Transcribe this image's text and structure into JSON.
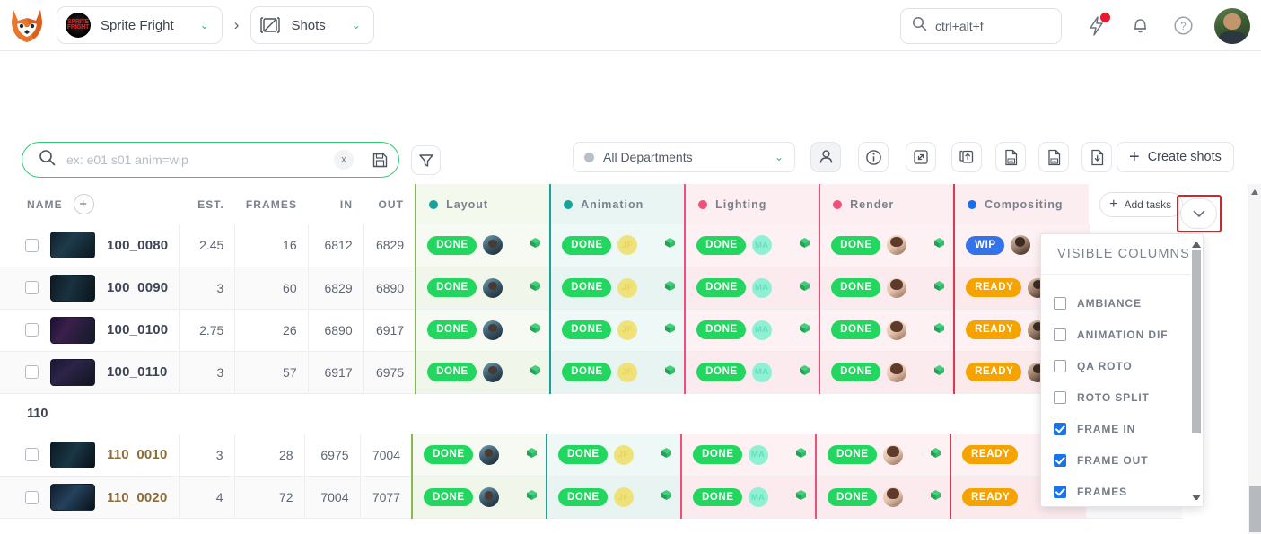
{
  "topbar": {
    "logo_name": "fox-logo",
    "project": "Sprite Fright",
    "project_thumb_text": "SPRITE FRIGHT",
    "breadcrumb_sep": "›",
    "entity": "Shots",
    "search_value": "ctrl+alt+f",
    "icons": [
      "lightning-icon",
      "bell-icon",
      "help-icon",
      "user-avatar"
    ]
  },
  "filterbar": {
    "search_placeholder": "ex: e01 s01 anim=wip",
    "clear_label": "x",
    "save_icon": "save-disk-icon",
    "filter_icon": "funnel-icon",
    "folder_icon": "folder-add-icon",
    "department": "All Departments",
    "person_icon": "person-icon",
    "info_icon": "info-circle-icon",
    "expand_icon": "expand-arrows-icon",
    "upload_icon": "upload-stack-icon",
    "edl_icon": "edl-file-icon",
    "csv_icon": "csv-file-icon",
    "download_icon": "download-file-icon",
    "create_label": "Create shots",
    "create_plus": "+"
  },
  "table": {
    "headers": {
      "name": "NAME",
      "add_column": "+",
      "est": "EST.",
      "frames": "FRAMES",
      "in": "IN",
      "out": "OUT"
    },
    "task_columns": [
      {
        "label": "Layout",
        "color": "#17a398"
      },
      {
        "label": "Animation",
        "color": "#17a398"
      },
      {
        "label": "Lighting",
        "color": "#f0507a"
      },
      {
        "label": "Render",
        "color": "#f0507a"
      },
      {
        "label": "Compositing",
        "color": "#1a6fe8"
      }
    ],
    "add_tasks_label": "Add tasks",
    "add_tasks_plus": "+",
    "expand_chevron": "chevron-down-icon",
    "groups": [
      {
        "name": "",
        "rows": [
          {
            "shot": "100_0080",
            "est": "2.45",
            "frames": "16",
            "in": "6812",
            "out": "6829",
            "tasks": [
              {
                "status": "DONE",
                "cls": "b-done",
                "av": "av-img1",
                "ini": ""
              },
              {
                "status": "DONE",
                "cls": "b-done",
                "av": "av-jf",
                "ini": "JF"
              },
              {
                "status": "DONE",
                "cls": "b-done",
                "av": "av-ma",
                "ini": "MA"
              },
              {
                "status": "DONE",
                "cls": "b-done",
                "av": "av-img2",
                "ini": ""
              },
              {
                "status": "WIP",
                "cls": "b-wip",
                "av": "av-img3",
                "ini": ""
              }
            ]
          },
          {
            "shot": "100_0090",
            "est": "3",
            "frames": "60",
            "in": "6829",
            "out": "6890",
            "tasks": [
              {
                "status": "DONE",
                "cls": "b-done",
                "av": "av-img1",
                "ini": ""
              },
              {
                "status": "DONE",
                "cls": "b-done",
                "av": "av-jf",
                "ini": "JF"
              },
              {
                "status": "DONE",
                "cls": "b-done",
                "av": "av-ma",
                "ini": "MA"
              },
              {
                "status": "DONE",
                "cls": "b-done",
                "av": "av-img2",
                "ini": ""
              },
              {
                "status": "READY",
                "cls": "b-ready",
                "av": "av-img3",
                "ini": ""
              }
            ]
          },
          {
            "shot": "100_0100",
            "est": "2.75",
            "frames": "26",
            "in": "6890",
            "out": "6917",
            "tasks": [
              {
                "status": "DONE",
                "cls": "b-done",
                "av": "av-img1",
                "ini": ""
              },
              {
                "status": "DONE",
                "cls": "b-done",
                "av": "av-jf",
                "ini": "JF"
              },
              {
                "status": "DONE",
                "cls": "b-done",
                "av": "av-ma",
                "ini": "MA"
              },
              {
                "status": "DONE",
                "cls": "b-done",
                "av": "av-img2",
                "ini": ""
              },
              {
                "status": "READY",
                "cls": "b-ready",
                "av": "av-img3",
                "ini": ""
              }
            ]
          },
          {
            "shot": "100_0110",
            "est": "3",
            "frames": "57",
            "in": "6917",
            "out": "6975",
            "tasks": [
              {
                "status": "DONE",
                "cls": "b-done",
                "av": "av-img1",
                "ini": ""
              },
              {
                "status": "DONE",
                "cls": "b-done",
                "av": "av-jf",
                "ini": "JF"
              },
              {
                "status": "DONE",
                "cls": "b-done",
                "av": "av-ma",
                "ini": "MA"
              },
              {
                "status": "DONE",
                "cls": "b-done",
                "av": "av-img2",
                "ini": ""
              },
              {
                "status": "READY",
                "cls": "b-ready",
                "av": "av-img3",
                "ini": ""
              }
            ]
          }
        ]
      },
      {
        "name": "110",
        "rows": [
          {
            "shot": "110_0010",
            "gold": true,
            "est": "3",
            "frames": "28",
            "in": "6975",
            "out": "7004",
            "tasks": [
              {
                "status": "DONE",
                "cls": "b-done",
                "av": "av-img1",
                "ini": ""
              },
              {
                "status": "DONE",
                "cls": "b-done",
                "av": "av-jf",
                "ini": "JF"
              },
              {
                "status": "DONE",
                "cls": "b-done",
                "av": "av-ma",
                "ini": "MA"
              },
              {
                "status": "DONE",
                "cls": "b-done",
                "av": "av-img2",
                "ini": ""
              },
              {
                "status": "READY",
                "cls": "b-ready",
                "av": "",
                "ini": ""
              }
            ]
          },
          {
            "shot": "110_0020",
            "gold": true,
            "est": "4",
            "frames": "72",
            "in": "7004",
            "out": "7077",
            "tasks": [
              {
                "status": "DONE",
                "cls": "b-done",
                "av": "av-img1",
                "ini": ""
              },
              {
                "status": "DONE",
                "cls": "b-done",
                "av": "av-jf",
                "ini": "JF"
              },
              {
                "status": "DONE",
                "cls": "b-done",
                "av": "av-ma",
                "ini": "MA"
              },
              {
                "status": "DONE",
                "cls": "b-done",
                "av": "av-img2",
                "ini": ""
              },
              {
                "status": "READY",
                "cls": "b-ready",
                "av": "",
                "ini": ""
              }
            ]
          }
        ]
      }
    ]
  },
  "visible_columns": {
    "title": "VISIBLE COLUMNS",
    "items": [
      {
        "label": "AMBIANCE",
        "checked": false
      },
      {
        "label": "ANIMATION DIF",
        "checked": false
      },
      {
        "label": "QA ROTO",
        "checked": false
      },
      {
        "label": "ROTO SPLIT",
        "checked": false
      },
      {
        "label": "FRAME IN",
        "checked": true
      },
      {
        "label": "FRAME OUT",
        "checked": true
      },
      {
        "label": "FRAMES",
        "checked": true
      }
    ]
  },
  "colors": {
    "accent_green": "#2ecc71",
    "done": "#22d65f",
    "wip": "#3472e8",
    "ready": "#f5a300",
    "checkbox_on": "#1a73e8",
    "highlight_red": "#f01818"
  }
}
